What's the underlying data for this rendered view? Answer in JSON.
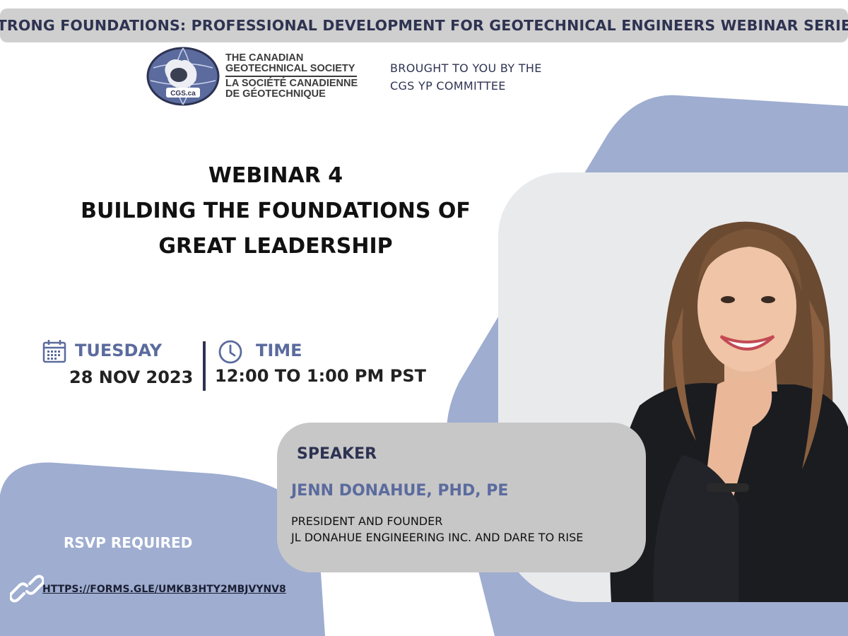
{
  "header": {
    "series_title": "STRONG FOUNDATIONS: PROFESSIONAL DEVELOPMENT FOR GEOTECHNICAL ENGINEERS WEBINAR SERIES"
  },
  "logo": {
    "badge_text": "CGS.ca",
    "line1": "THE CANADIAN",
    "line2": "GEOTECHNICAL SOCIETY",
    "line3": "LA SOCIÉTÉ CANADIENNE",
    "line4": "DE GÉOTECHNIQUE"
  },
  "sponsor": {
    "line1": "BROUGHT TO YOU BY THE",
    "line2": "CGS YP COMMITTEE"
  },
  "event": {
    "number": "WEBINAR 4",
    "title_line1": "BUILDING THE FOUNDATIONS OF",
    "title_line2": "GREAT LEADERSHIP"
  },
  "schedule": {
    "day": "TUESDAY",
    "date": "28 NOV 2023",
    "time_label": "TIME",
    "time_value": "12:00 TO 1:00 PM PST"
  },
  "speaker": {
    "section_label": "SPEAKER",
    "name": "JENN DONAHUE, PHD, PE",
    "role_line1": "PRESIDENT AND FOUNDER",
    "role_line2": "JL DONAHUE ENGINEERING INC. AND DARE TO RISE"
  },
  "rsvp": {
    "label": "RSVP REQUIRED",
    "url": "HTTPS://FORMS.GLE/UMKB3HTY2MBJVYNV8"
  },
  "icons": {
    "date": "calendar-icon",
    "time": "clock-icon",
    "link": "link-icon"
  },
  "colors": {
    "accent_blue": "#5b6b9e",
    "shape_blue": "#9eadd0",
    "navy": "#2e3352",
    "banner_gray": "#cfcfcf",
    "card_gray": "#c7c7c7"
  }
}
